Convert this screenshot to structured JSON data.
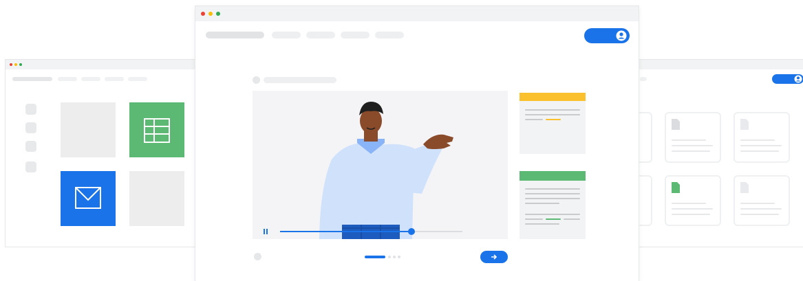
{
  "colors": {
    "accent": "#1a73e8",
    "green": "#5bb974",
    "yellow": "#fbc02d",
    "red": "#ea4335",
    "window_dot_yellow": "#fbbc04",
    "window_dot_green": "#34a853",
    "placeholder": "#e8eaed",
    "skin": "#8a4b2b",
    "shirt": "#cfe1fb",
    "pants": "#1d5bbf"
  },
  "icons": {
    "sheets": "spreadsheet-grid-icon",
    "mail": "envelope-icon",
    "account": "account-circle-icon",
    "next": "arrow-right-icon",
    "pause": "pause-icon",
    "document": "document-icon"
  },
  "video": {
    "progress": 0.72
  },
  "carousel": {
    "active_index": 0,
    "count": 4
  }
}
